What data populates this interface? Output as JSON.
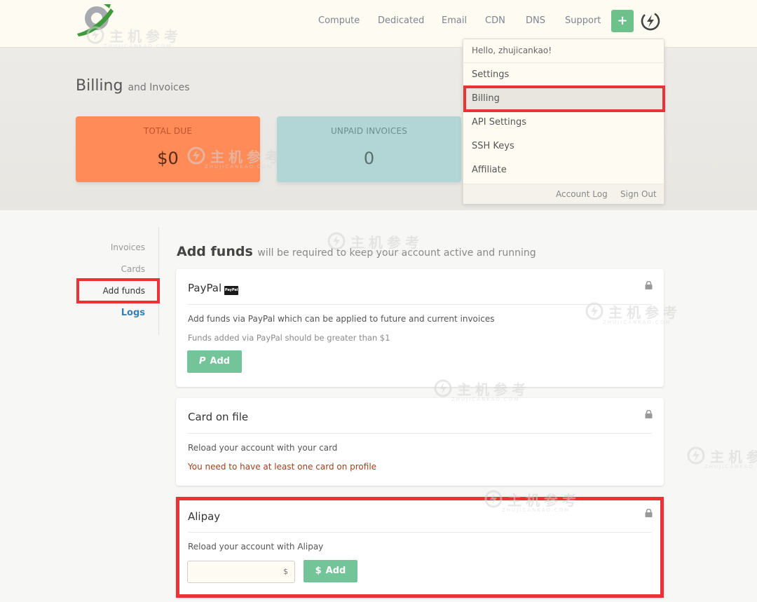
{
  "nav": {
    "links": [
      "Compute",
      "Dedicated",
      "Email",
      "CDN",
      "DNS",
      "Support"
    ],
    "plus_label": "+"
  },
  "page": {
    "title": "Billing",
    "subtitle": "and Invoices"
  },
  "stats": {
    "total_due_label": "TOTAL DUE",
    "total_due_value": "$0",
    "unpaid_label": "UNPAID INVOICES",
    "unpaid_value": "0"
  },
  "dropdown": {
    "greeting": "Hello, zhujicankao!",
    "items": [
      "Settings",
      "Billing",
      "API Settings",
      "SSH Keys",
      "Affiliate"
    ],
    "footer": [
      "Account Log",
      "Sign Out"
    ]
  },
  "sidebar": {
    "items": [
      "Invoices",
      "Cards",
      "Add funds",
      "Logs"
    ]
  },
  "main": {
    "title": "Add funds",
    "subtitle": "will be required to keep your account active and running",
    "paypal": {
      "title": "PayPal",
      "badge": "PayPal",
      "desc": "Add funds via PayPal which can be applied to future and current invoices",
      "note": "Funds added via PayPal should be greater than $1",
      "button": "Add",
      "button_icon": "P"
    },
    "card_on_file": {
      "title": "Card on file",
      "desc": "Reload your account with your card",
      "warning": "You need to have at least one card on profile"
    },
    "alipay": {
      "title": "Alipay",
      "desc": "Reload your account with Alipay",
      "currency": "$",
      "button": "Add",
      "button_icon": "$"
    }
  },
  "watermark": {
    "cn": "主机参考",
    "en": "ZHUJICANKAO.COM"
  },
  "colors": {
    "accent_green": "#74c499",
    "highlight_red": "#ea3237",
    "total_due_bg": "#ff8b59",
    "unpaid_bg": "#b2d6d5"
  }
}
